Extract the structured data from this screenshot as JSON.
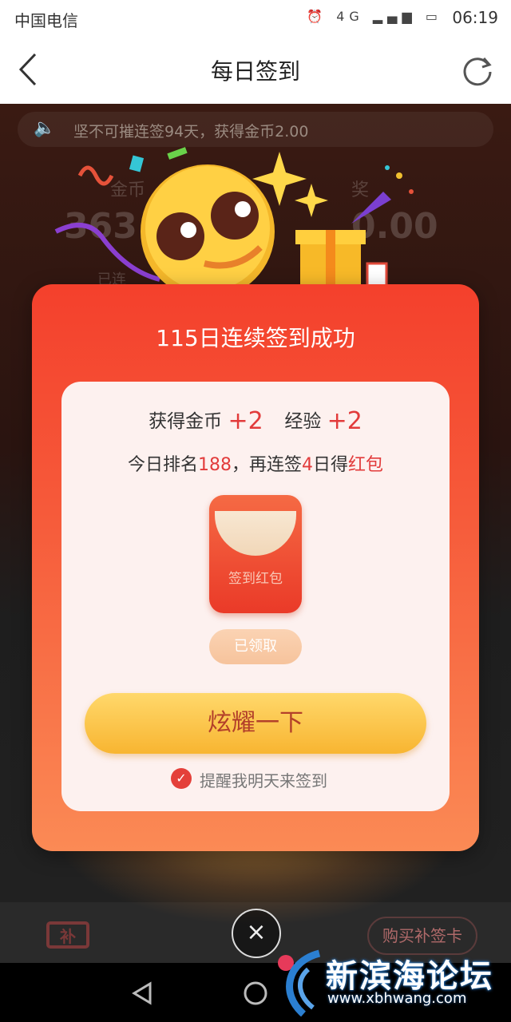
{
  "status_bar": {
    "carrier": "中国电信",
    "time": "06:19",
    "network": "4G"
  },
  "nav": {
    "title": "每日签到"
  },
  "background": {
    "notice": "坚不可摧连签94天，获得金币2.00",
    "coins_label": "金币",
    "reward_label": "奖",
    "coins_partial": "363",
    "reward_amount_partial": "0.00",
    "streak_partial": "已连",
    "buy_card_button": "购买补签卡"
  },
  "modal": {
    "title": "115日连续签到成功",
    "reward": {
      "coins_label": "获得金币",
      "coins_value": "+2",
      "exp_label": "经验",
      "exp_value": "+2"
    },
    "rank": {
      "prefix": "今日排名",
      "rank_value": "188",
      "middle": "，再连签",
      "days_value": "4",
      "suffix": "日得",
      "reward_word": "红包"
    },
    "envelope_label": "签到红包",
    "claimed_button": "已领取",
    "show_off_button": "炫耀一下",
    "remind_text": "提醒我明天来签到",
    "remind_checked": true
  },
  "watermark": {
    "title": "新滨海论坛",
    "url": "www.xbhwang.com"
  },
  "colors": {
    "modal_red": "#f4402c",
    "accent_red": "#e23b3b",
    "button_gold": "#f8b531"
  }
}
